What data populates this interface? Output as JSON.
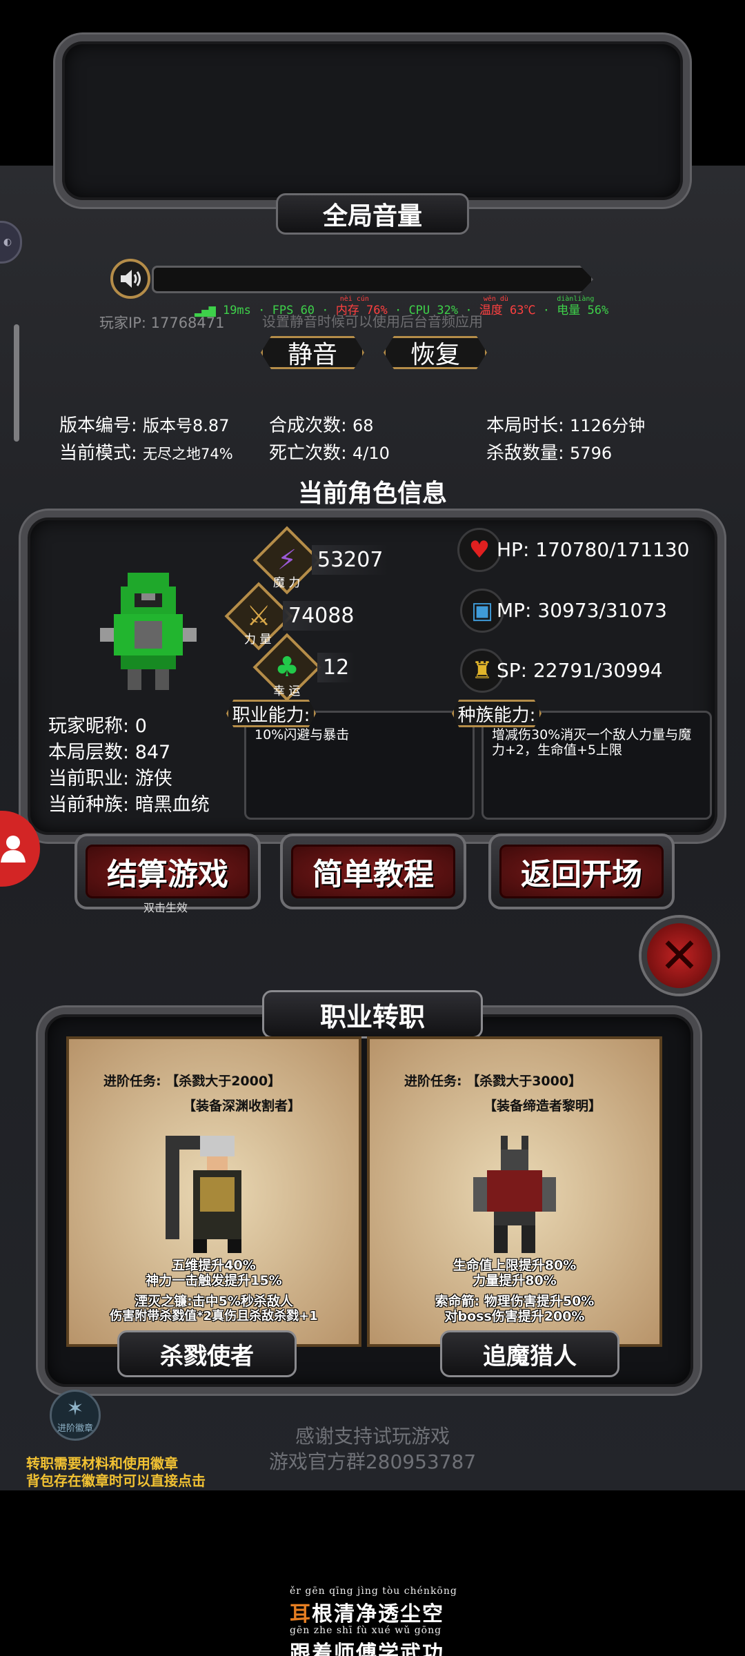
{
  "volume": {
    "title": "全局音量",
    "perf_overlay": {
      "ping": "19ms",
      "fps": "FPS 60",
      "mem_pinyin": "nèi cún",
      "mem": "内存 76%",
      "cpu": "CPU 32%",
      "temp_pinyin": "wēn dù",
      "temp": "温度 63℃",
      "battery_pinyin": "diànliàng",
      "battery": "电量 56%"
    },
    "hint": "设置静音时候可以使用后台音频应用",
    "player_ip": "玩家IP: 17768471",
    "mute_label": "静音",
    "restore_label": "恢复"
  },
  "stats": {
    "version_label": "版本编号:",
    "version_value": "版本号8.87",
    "mode_label": "当前模式:",
    "mode_value": "无尽之地74%",
    "synth_label": "合成次数:",
    "synth_value": "68",
    "death_label": "死亡次数:",
    "death_value": "4/10",
    "time_label": "本局时长:",
    "time_value": "1126分钟",
    "kills_label": "杀敌数量:",
    "kills_value": "5796"
  },
  "character": {
    "section_title": "当前角色信息",
    "magic_label": "魔 力",
    "magic_value": "53207",
    "strength_label": "力 量",
    "strength_value": "74088",
    "luck_label": "幸 运",
    "luck_value": "12",
    "hp": "HP:  170780/171130",
    "mp": "MP:  30973/31073",
    "sp": "SP:  22791/30994",
    "nickname_label": "玩家昵称:",
    "nickname_value": "0",
    "floor_label": "本局层数:",
    "floor_value": "847",
    "class_label": "当前职业:",
    "class_value": "游侠",
    "race_label": "当前种族:",
    "race_value": "暗黑血统",
    "class_ability_tag": "职业能力:",
    "class_ability_text": "10%闪避与暴击",
    "race_ability_tag": "种族能力:",
    "race_ability_text": "增减伤30%消灭一个敌人力量与魔力+2，生命值+5上限"
  },
  "buttons": {
    "settle": "结算游戏",
    "settle_sub": "双击生效",
    "tutorial": "简单教程",
    "return": "返回开场"
  },
  "job_change": {
    "title": "职业转职",
    "cards": [
      {
        "task": "进阶任务:  【杀戮大于2000】",
        "req": "【装备深渊收割者】",
        "desc1": "五维提升40%",
        "desc2": "神力一击触发提升15%",
        "desc3": "湮灭之镰:击中5%秒杀敌人",
        "desc4": "伤害附带杀戮值*2真伤且杀敌杀戮+1",
        "name": "杀戮使者"
      },
      {
        "task": "进阶任务:  【杀戮大于3000】",
        "req": "【装备缔造者黎明】",
        "desc1": "生命值上限提升80%",
        "desc2": "力量提升80%",
        "desc3": "索命箭: 物理伤害提升50%",
        "desc4": "对boss伤害提升200%",
        "name": "追魔猎人"
      }
    ],
    "emblem_label": "进阶徽章",
    "thanks1": "感谢支持试玩游戏",
    "thanks2": "游戏官方群280953787",
    "note1": "转职需要材料和使用徽章",
    "note2": "背包存在徽章时可以直接点击"
  },
  "poem": {
    "line1_pinyin": "ěr gēn qīng jìng tòu chénkōng",
    "line1_first": "耳",
    "line1_rest": "根清净透尘空",
    "line2_pinyin": "gēn zhe shī fù xué wǔ gōng",
    "line2": "跟着师傅学武功"
  },
  "colors": {
    "gold": "#b58d49",
    "red_button": "#7d1a1a",
    "perf_green": "#3ed14a",
    "perf_red": "#ff4040",
    "note_yellow": "#f2c233"
  }
}
